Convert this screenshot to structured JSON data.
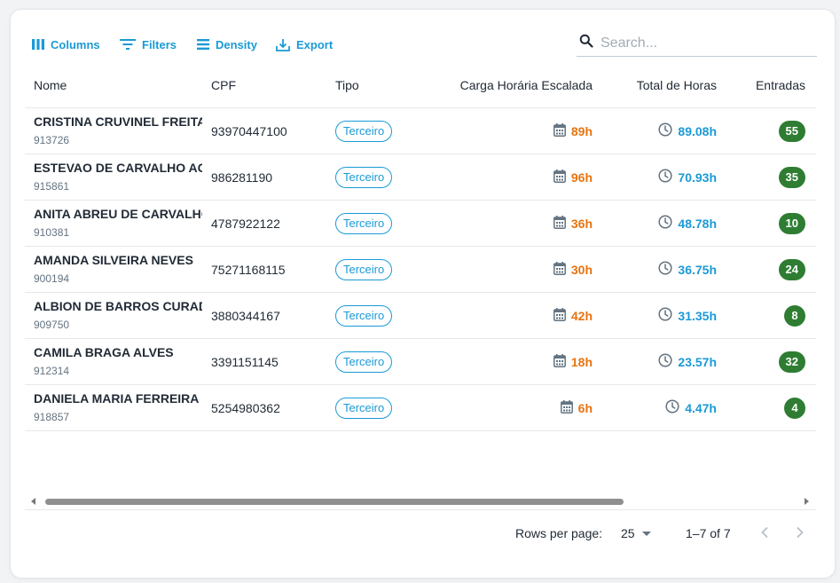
{
  "toolbar": {
    "columns_label": "Columns",
    "filters_label": "Filters",
    "density_label": "Density",
    "export_label": "Export"
  },
  "search": {
    "placeholder": "Search...",
    "value": ""
  },
  "table": {
    "headers": [
      "Nome",
      "CPF",
      "Tipo",
      "Carga Horária Escalada",
      "Total de Horas",
      "Entradas"
    ],
    "rows": [
      {
        "name": "CRISTINA CRUVINEL FREITA",
        "matricula": "913726",
        "cpf": "93970447100",
        "tipo": "Terceiro",
        "carga": "89h",
        "total": "89.08h",
        "entradas": "55"
      },
      {
        "name": "ESTEVAO DE CARVALHO AG",
        "matricula": "915861",
        "cpf": "986281190",
        "tipo": "Terceiro",
        "carga": "96h",
        "total": "70.93h",
        "entradas": "35"
      },
      {
        "name": "ANITA ABREU DE CARVALHO",
        "matricula": "910381",
        "cpf": "4787922122",
        "tipo": "Terceiro",
        "carga": "36h",
        "total": "48.78h",
        "entradas": "10"
      },
      {
        "name": "AMANDA SILVEIRA NEVES",
        "matricula": "900194",
        "cpf": "75271168115",
        "tipo": "Terceiro",
        "carga": "30h",
        "total": "36.75h",
        "entradas": "24"
      },
      {
        "name": "ALBION DE BARROS CURAD",
        "matricula": "909750",
        "cpf": "3880344167",
        "tipo": "Terceiro",
        "carga": "42h",
        "total": "31.35h",
        "entradas": "8"
      },
      {
        "name": "CAMILA BRAGA ALVES",
        "matricula": "912314",
        "cpf": "3391151145",
        "tipo": "Terceiro",
        "carga": "18h",
        "total": "23.57h",
        "entradas": "32"
      },
      {
        "name": "DANIELA MARIA FERREIRA F",
        "matricula": "918857",
        "cpf": "5254980362",
        "tipo": "Terceiro",
        "carga": "6h",
        "total": "4.47h",
        "entradas": "4"
      }
    ]
  },
  "pagination": {
    "rows_per_page_label": "Rows per page:",
    "rows_per_page": "25",
    "range": "1–7 of 7"
  },
  "colors": {
    "accent": "#1a9ad6",
    "carga": "#e8730f",
    "entradas_badge": "#2e7d32"
  },
  "icons": {
    "columns": "columns-icon",
    "filters": "filter-icon",
    "density": "density-icon",
    "export": "export-icon",
    "search": "search-icon",
    "carga": "calendar-icon",
    "total": "clock-icon"
  }
}
